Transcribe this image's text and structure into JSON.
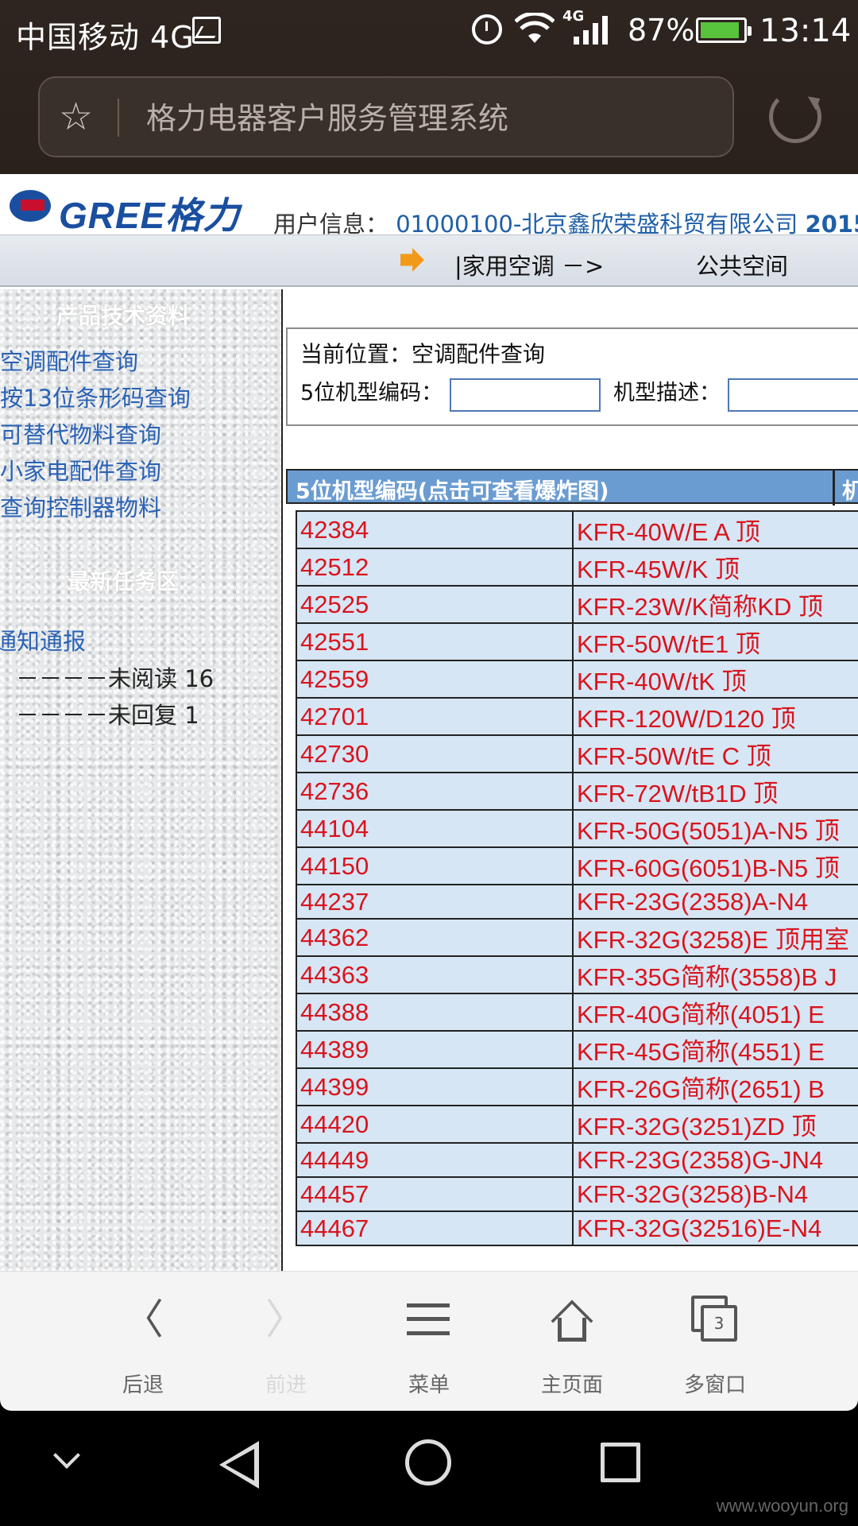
{
  "status_bar": {
    "carrier": "中国移动 4G",
    "network_badge": "4G",
    "battery": "87%",
    "time": "13:14"
  },
  "browser": {
    "url_title": "格力电器客户服务管理系统"
  },
  "header": {
    "logo_text": "GREE格力",
    "user_info_label": "用户信息：",
    "user_info_value": "01000100-北京鑫欣荣盛科贸有限公司",
    "user_info_year": "2015"
  },
  "nav": {
    "item1": "|家用空调 －>",
    "item2": "公共空间"
  },
  "sidebar": {
    "heading1": "产品技术资料",
    "links": [
      "空调配件查询",
      "按13位条形码查询",
      "可替代物料查询",
      "小家电配件查询",
      "查询控制器物料"
    ],
    "heading2": "最新任务区",
    "notice_link": "通知通报",
    "unread": "－－－－未阅读  16",
    "unreplied": "－－－－未回复  1"
  },
  "search": {
    "location": "当前位置：空调配件查询",
    "code_label": "5位机型编码：",
    "code_value": "",
    "desc_label": "机型描述：",
    "desc_value": ""
  },
  "table": {
    "header_col1": "5位机型编码(点击可查看爆炸图)",
    "header_col2": "机",
    "rows": [
      [
        "42384",
        "KFR-40W/E A 顶"
      ],
      [
        "42512",
        "KFR-45W/K 顶"
      ],
      [
        "42525",
        "KFR-23W/K简称KD 顶"
      ],
      [
        "42551",
        "KFR-50W/tE1 顶"
      ],
      [
        "42559",
        "KFR-40W/tK 顶"
      ],
      [
        "42701",
        "KFR-120W/D120 顶"
      ],
      [
        "42730",
        "KFR-50W/tE C 顶"
      ],
      [
        "42736",
        "KFR-72W/tB1D 顶"
      ],
      [
        "44104",
        "KFR-50G(5051)A-N5 顶"
      ],
      [
        "44150",
        "KFR-60G(6051)B-N5 顶"
      ],
      [
        "44237",
        "KFR-23G(2358)A-N4"
      ],
      [
        "44362",
        "KFR-32G(3258)E 顶用室"
      ],
      [
        "44363",
        "KFR-35G简称(3558)B J"
      ],
      [
        "44388",
        "KFR-40G简称(4051) E"
      ],
      [
        "44389",
        "KFR-45G简称(4551) E"
      ],
      [
        "44399",
        "KFR-26G简称(2651) B"
      ],
      [
        "44420",
        "KFR-32G(3251)ZD 顶"
      ],
      [
        "44449",
        "KFR-23G(2358)G-JN4"
      ],
      [
        "44457",
        "KFR-32G(3258)B-N4"
      ],
      [
        "44467",
        "KFR-32G(32516)E-N4"
      ]
    ]
  },
  "toolbar": {
    "back": "后退",
    "forward": "前进",
    "menu": "菜单",
    "home": "主页面",
    "windows": "多窗口",
    "windows_count": "3"
  },
  "watermark": "www.wooyun.org",
  "colors": {
    "link_blue": "#2a62b4",
    "table_header": "#6b9cd1",
    "row_bg": "#d6e6f5",
    "row_text": "#d9141d",
    "nav_arrow": "#f19a1a"
  }
}
